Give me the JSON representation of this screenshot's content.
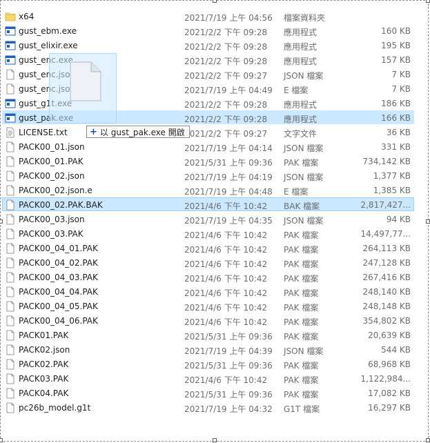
{
  "files": [
    {
      "name": "x64",
      "date": "2021/7/19 上午 04:56",
      "type": "檔案資料夾",
      "size": "",
      "icon": "folder-icon"
    },
    {
      "name": "gust_ebm.exe",
      "date": "2021/2/2 下午 09:28",
      "type": "應用程式",
      "size": "160 KB",
      "icon": "exe-icon"
    },
    {
      "name": "gust_elixir.exe",
      "date": "2021/2/2 下午 09:28",
      "type": "應用程式",
      "size": "195 KB",
      "icon": "exe-icon"
    },
    {
      "name": "gust_enc.exe",
      "date": "2021/2/2 下午 09:28",
      "type": "應用程式",
      "size": "157 KB",
      "icon": "exe-icon"
    },
    {
      "name": "gust_enc.json",
      "date": "2021/2/2 下午 09:27",
      "type": "JSON 檔案",
      "size": "7 KB",
      "icon": "file-icon"
    },
    {
      "name": "gust_enc.json.e",
      "date": "2021/7/19 上午 04:49",
      "type": "E 檔案",
      "size": "7 KB",
      "icon": "file-icon"
    },
    {
      "name": "gust_g1t.exe",
      "date": "2021/2/2 下午 09:28",
      "type": "應用程式",
      "size": "186 KB",
      "icon": "exe-icon"
    },
    {
      "name": "gust_pak.exe",
      "date": "2021/2/2 下午 09:28",
      "type": "應用程式",
      "size": "166 KB",
      "icon": "exe-icon"
    },
    {
      "name": "LICENSE.txt",
      "date": "2021/2/2 下午 09:27",
      "type": "文字文件",
      "size": "36 KB",
      "icon": "text-file-icon"
    },
    {
      "name": "PACK00_01.json",
      "date": "2021/7/19 上午 04:14",
      "type": "JSON 檔案",
      "size": "331 KB",
      "icon": "file-icon"
    },
    {
      "name": "PACK00_01.PAK",
      "date": "2021/5/31 上午 09:36",
      "type": "PAK 檔案",
      "size": "734,142 KB",
      "icon": "file-icon"
    },
    {
      "name": "PACK00_02.json",
      "date": "2021/7/19 上午 04:19",
      "type": "JSON 檔案",
      "size": "1,377 KB",
      "icon": "file-icon"
    },
    {
      "name": "PACK00_02.json.e",
      "date": "2021/7/19 上午 04:48",
      "type": "E 檔案",
      "size": "1,385 KB",
      "icon": "file-icon"
    },
    {
      "name": "PACK00_02.PAK.BAK",
      "date": "2021/4/6 下午 10:42",
      "type": "BAK 檔案",
      "size": "2,817,427...",
      "icon": "file-icon"
    },
    {
      "name": "PACK00_03.json",
      "date": "2021/7/19 上午 04:35",
      "type": "JSON 檔案",
      "size": "94 KB",
      "icon": "file-icon"
    },
    {
      "name": "PACK00_03.PAK",
      "date": "2021/4/6 下午 10:42",
      "type": "PAK 檔案",
      "size": "14,497,77...",
      "icon": "file-icon"
    },
    {
      "name": "PACK00_04_01.PAK",
      "date": "2021/4/6 下午 10:42",
      "type": "PAK 檔案",
      "size": "264,113 KB",
      "icon": "file-icon"
    },
    {
      "name": "PACK00_04_02.PAK",
      "date": "2021/4/6 下午 10:42",
      "type": "PAK 檔案",
      "size": "247,128 KB",
      "icon": "file-icon"
    },
    {
      "name": "PACK00_04_03.PAK",
      "date": "2021/4/6 下午 10:42",
      "type": "PAK 檔案",
      "size": "267,416 KB",
      "icon": "file-icon"
    },
    {
      "name": "PACK00_04_04.PAK",
      "date": "2021/4/6 下午 10:42",
      "type": "PAK 檔案",
      "size": "248,140 KB",
      "icon": "file-icon"
    },
    {
      "name": "PACK00_04_05.PAK",
      "date": "2021/4/6 下午 10:42",
      "type": "PAK 檔案",
      "size": "248,148 KB",
      "icon": "file-icon"
    },
    {
      "name": "PACK00_04_06.PAK",
      "date": "2021/4/6 下午 10:42",
      "type": "PAK 檔案",
      "size": "354,802 KB",
      "icon": "file-icon"
    },
    {
      "name": "PACK01.PAK",
      "date": "2021/5/31 上午 09:36",
      "type": "PAK 檔案",
      "size": "20,639 KB",
      "icon": "file-icon"
    },
    {
      "name": "PACK02.json",
      "date": "2021/7/19 上午 04:39",
      "type": "JSON 檔案",
      "size": "544 KB",
      "icon": "file-icon"
    },
    {
      "name": "PACK02.PAK",
      "date": "2021/5/31 上午 09:36",
      "type": "PAK 檔案",
      "size": "68,968 KB",
      "icon": "file-icon"
    },
    {
      "name": "PACK03.PAK",
      "date": "2021/4/6 下午 10:42",
      "type": "PAK 檔案",
      "size": "1,122,984...",
      "icon": "file-icon"
    },
    {
      "name": "PACK04.PAK",
      "date": "2021/5/31 上午 09:36",
      "type": "PAK 檔案",
      "size": "17,082 KB",
      "icon": "file-icon"
    },
    {
      "name": "pc26b_model.g1t",
      "date": "2021/7/19 上午 04:32",
      "type": "G1T 檔案",
      "size": "16,297 KB",
      "icon": "file-icon"
    }
  ],
  "hover_index": 7,
  "selected_index": 13,
  "drag": {
    "tooltip_plus": "+",
    "tooltip_text": "以 gust_pak.exe 開啟"
  },
  "colors": {
    "selection": "#cce8ff",
    "selection_border": "#99d1ff",
    "exe_blue": "#1f5fbf",
    "folder_yellow": "#f8d775"
  }
}
